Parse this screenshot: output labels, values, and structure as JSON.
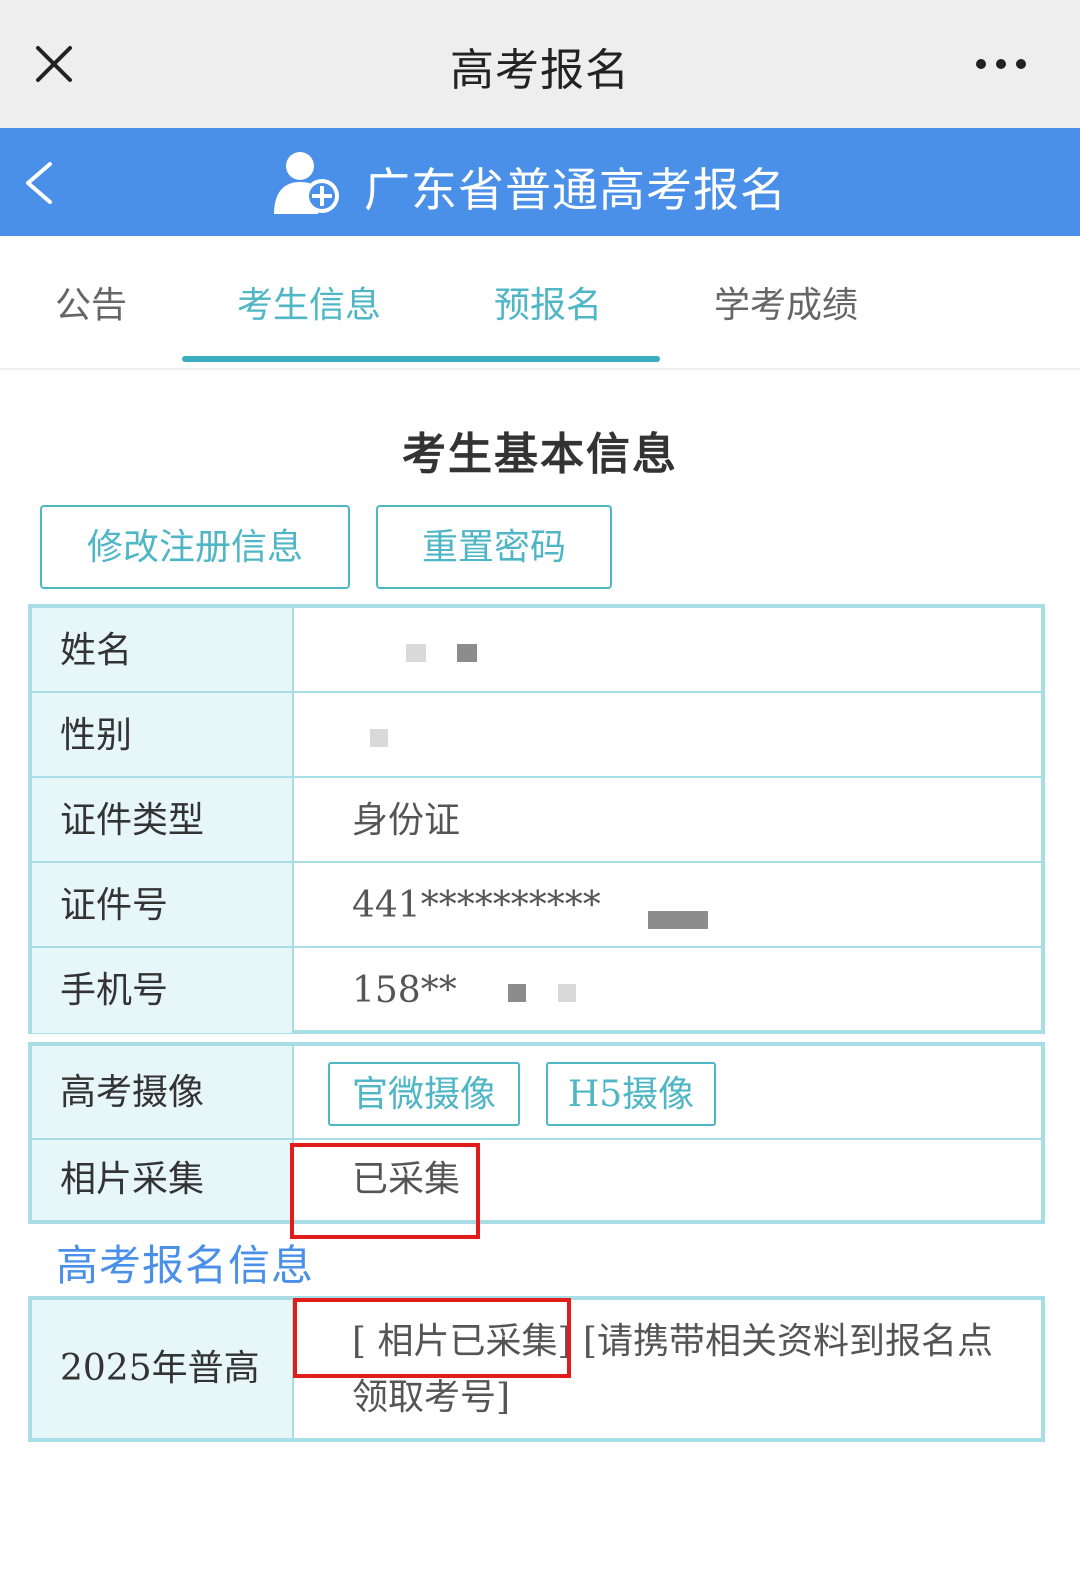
{
  "wechat_bar": {
    "title": "高考报名",
    "close_icon": "close-icon",
    "more_icon": "more-icon"
  },
  "header": {
    "title": "广东省普通高考报名",
    "back_icon": "chevron-left-icon",
    "user_icon": "user-add-icon",
    "background": "#4a90e8"
  },
  "tabs": [
    {
      "label": "公告",
      "active": false
    },
    {
      "label": "考生信息",
      "active": true
    },
    {
      "label": "预报名",
      "active": true
    },
    {
      "label": "学考成绩",
      "active": false
    }
  ],
  "section_title": "考生基本信息",
  "buttons": {
    "edit_registration": "修改注册信息",
    "reset_password": "重置密码"
  },
  "basic_info": [
    {
      "label": "姓名",
      "value": ""
    },
    {
      "label": "性别",
      "value": ""
    },
    {
      "label": "证件类型",
      "value": "身份证"
    },
    {
      "label": "证件号",
      "value": "441**********"
    },
    {
      "label": "手机号",
      "value": "158**"
    }
  ],
  "photo_info": {
    "camera_label": "高考摄像",
    "camera_buttons": [
      "官微摄像",
      "H5摄像"
    ],
    "photo_label": "相片采集",
    "photo_value": "已采集"
  },
  "registration_heading": "高考报名信息",
  "registration": {
    "label": "2025年普高",
    "value": "[ 相片已采集]    [请携带相关资料到报名点领取考号]"
  },
  "colors": {
    "accent_teal": "#4fb6c6",
    "table_border": "#a9dde6",
    "label_bg": "#e7f6f9",
    "highlight_red": "#e21b1b"
  }
}
